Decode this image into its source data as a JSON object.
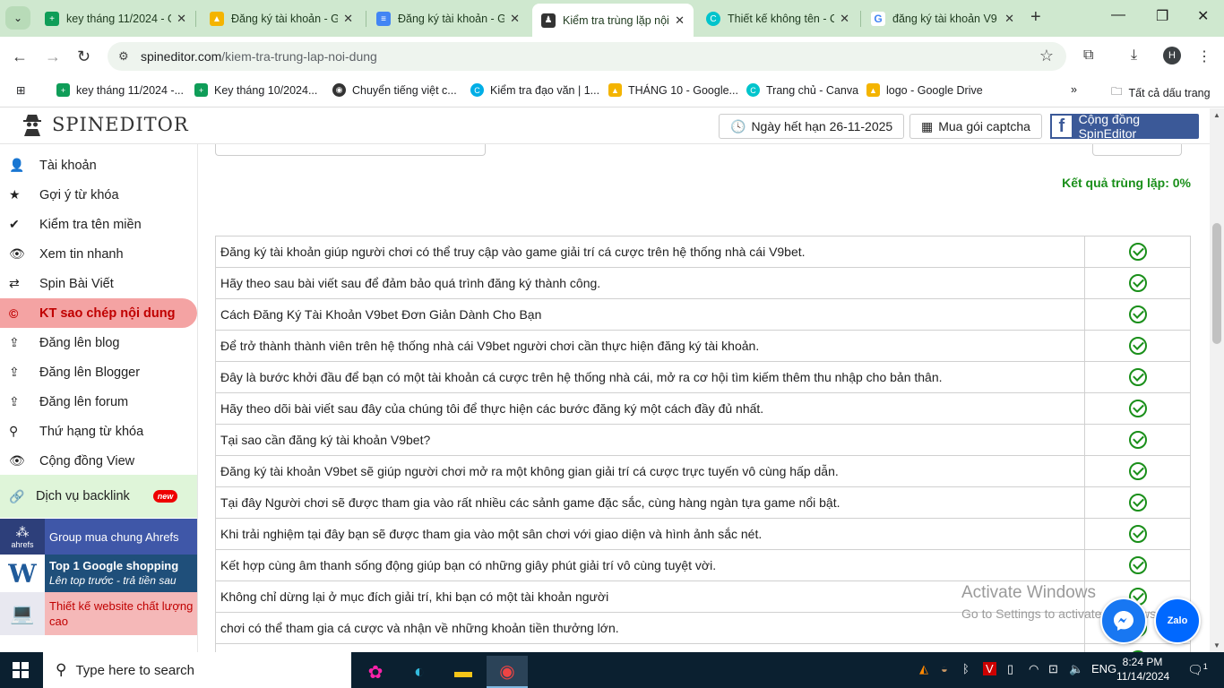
{
  "browser": {
    "tabs": [
      {
        "title": "key tháng 11/2024 - G",
        "icon": "sheets-icon",
        "color": "#0f9d58",
        "active": false
      },
      {
        "title": "Đăng ký tài khoản - G",
        "icon": "drive-icon",
        "color": "#f4b400",
        "active": false
      },
      {
        "title": "Đăng ký tài khoản - G",
        "icon": "docs-icon",
        "color": "#4285f4",
        "active": false
      },
      {
        "title": "Kiểm tra trùng lặp nội",
        "icon": "spy-icon",
        "color": "#333333",
        "active": true
      },
      {
        "title": "Thiết kế không tên - C",
        "icon": "canva-icon",
        "color": "#00c4cc",
        "active": false
      },
      {
        "title": "đăng ký tài khoản V9",
        "icon": "google-icon",
        "color": "#4285f4",
        "active": false
      }
    ],
    "url_site": "spineditor.com",
    "url_path": "/kiem-tra-trung-lap-noi-dung",
    "profile_initial": "H",
    "bookmarks": [
      {
        "label": "key tháng 11/2024 -...",
        "color": "#0f9d58",
        "icon": "sheets-icon"
      },
      {
        "label": "Key tháng 10/2024...",
        "color": "#0f9d58",
        "icon": "sheets-icon"
      },
      {
        "label": "Chuyển tiếng việt c...",
        "color": "#333333",
        "icon": "globe-icon"
      },
      {
        "label": "Kiểm tra đạo văn | 1...",
        "color": "#00aee6",
        "icon": "check-icon"
      },
      {
        "label": "THÁNG 10 - Google...",
        "color": "#f4b400",
        "icon": "drive-icon"
      },
      {
        "label": "Trang chủ - Canva",
        "color": "#00c4cc",
        "icon": "canva-icon"
      },
      {
        "label": "logo - Google Drive",
        "color": "#f4b400",
        "icon": "drive-icon"
      }
    ],
    "all_bookmarks_label": "Tất cả dấu trang"
  },
  "site": {
    "logo_text": "SPINEDITOR",
    "header_buttons": {
      "expiry": "Ngày hết hạn 26-11-2025",
      "captcha": "Mua gói captcha",
      "community": "Cộng đồng SpinEditor"
    },
    "sidebar": [
      {
        "label": "Tài khoản",
        "icon": "user-icon",
        "glyph": "👤"
      },
      {
        "label": "Gợi ý từ khóa",
        "icon": "star-icon",
        "glyph": "★"
      },
      {
        "label": "Kiểm tra tên miền",
        "icon": "check-icon",
        "glyph": "✔"
      },
      {
        "label": "Xem tin nhanh",
        "icon": "eye-icon",
        "glyph": "👁"
      },
      {
        "label": "Spin Bài Viết",
        "icon": "shuffle-icon",
        "glyph": "⇄"
      },
      {
        "label": "KT sao chép nội dung",
        "icon": "copyright-icon",
        "glyph": "©"
      },
      {
        "label": "Đăng lên blog",
        "icon": "upload-icon",
        "glyph": "⇪"
      },
      {
        "label": "Đăng lên Blogger",
        "icon": "upload-icon",
        "glyph": "⇪"
      },
      {
        "label": "Đăng lên forum",
        "icon": "upload-icon",
        "glyph": "⇪"
      },
      {
        "label": "Thứ hạng từ khóa",
        "icon": "search-icon",
        "glyph": "🔍"
      },
      {
        "label": "Cộng đồng View",
        "icon": "eye-icon",
        "glyph": "👁"
      }
    ],
    "backlink": {
      "label": "Dịch vụ backlink",
      "badge": "new"
    },
    "ads": {
      "ahrefs": {
        "label": "Group mua chung Ahrefs",
        "brand": "ahrefs"
      },
      "shopping": {
        "title": "Top 1 Google shopping",
        "subtitle": "Lên top trước - trả tiền sau"
      },
      "website": {
        "label": "Thiết kế website chất lượng cao"
      }
    },
    "result_label": "Kết quả trùng lặp: 0%",
    "rows": [
      "Đăng ký tài khoản giúp người chơi có thể truy cập vào game giải trí cá cược trên hệ thống nhà cái V9bet.",
      "Hãy theo sau bài viết sau để đảm bảo quá trình đăng ký thành công.",
      "Cách Đăng Ký Tài Khoản V9bet Đơn Giản Dành Cho Bạn",
      "Để trở thành thành viên trên hệ thống nhà cái V9bet người chơi cần thực hiện đăng ký tài khoản.",
      "Đây là bước khởi đầu để bạn có một tài khoản cá cược trên hệ thống nhà cái, mở ra cơ hội tìm kiếm thêm thu nhập cho bản thân.",
      "Hãy theo dõi bài viết sau đây của chúng tôi để thực hiện các bước đăng ký một cách đầy đủ nhất.",
      "Tại sao cần đăng ký tài khoản V9bet?",
      "Đăng ký tài khoản V9bet sẽ giúp người chơi mở ra một không gian giải trí cá cược trực tuyến vô cùng hấp dẫn.",
      "Tại đây Người chơi sẽ được tham gia vào rất nhiều các sảnh game đặc sắc, cùng hàng ngàn tựa game nổi bật.",
      "Khi trải nghiệm tại đây bạn sẽ được tham gia vào một sân chơi với giao diện và hình ảnh sắc nét.",
      "Kết hợp cùng âm thanh sống động giúp bạn có những giây phút giải trí vô cùng tuyệt vời.",
      "Không chỉ dừng lại ở mục đích giải trí, khi bạn có một tài khoản người",
      "chơi có thể tham gia cá cược và nhận về những khoản tiền thưởng lớn.",
      ""
    ],
    "activate_line1": "Activate Windows",
    "activate_line2": "Go to Settings to activate Windows.",
    "zalo_label": "Zalo"
  },
  "taskbar": {
    "search_placeholder": "Type here to search",
    "lang": "ENG",
    "time": "8:24 PM",
    "date": "11/14/2024",
    "notif_count": "1"
  },
  "colors": {
    "accent_green": "#1a8f1a",
    "active_menu_bg": "#f4a3a3",
    "active_menu_text": "#c00000",
    "facebook": "#3b5998",
    "chrome_frame": "#cfe8cf"
  }
}
